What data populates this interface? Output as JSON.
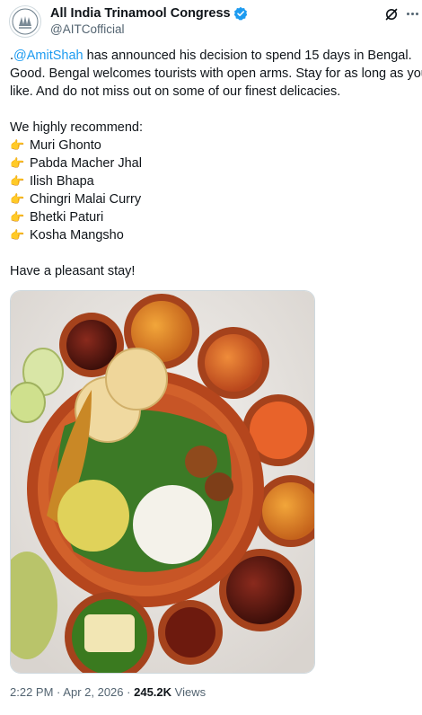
{
  "tweet": {
    "display_name": "All India Trinamool Congress",
    "handle": "@AITCofficial",
    "verified_icon": "verified-badge-icon",
    "lines": {
      "l1_prefix": ".",
      "l1_mention": "@AmitShah",
      "l1_rest": " has announced his decision to spend 15 days in Bengal.",
      "l2": "Good. Bengal welcomes tourists with open arms. Stay for as long as you",
      "l3": "like. And do not miss out on some of our finest delicacies.",
      "recommend": "We highly recommend:",
      "closing": "Have a pleasant stay!"
    },
    "dishes": [
      "Muri Ghonto",
      "Pabda Macher Jhal",
      "Ilish Bhapa",
      "Chingri Malai Curry",
      "Bhetki Paturi",
      "Kosha Mangsho"
    ],
    "bullet_glyph": "👉",
    "meta": {
      "time": "2:22 PM",
      "separator": "·",
      "date": "Apr 2, 2026",
      "views_count": "245.2K",
      "views_label": "Views"
    }
  },
  "colors": {
    "accent": "#1d9bf0",
    "secondary_text": "#536471",
    "border": "#cfd9de"
  }
}
